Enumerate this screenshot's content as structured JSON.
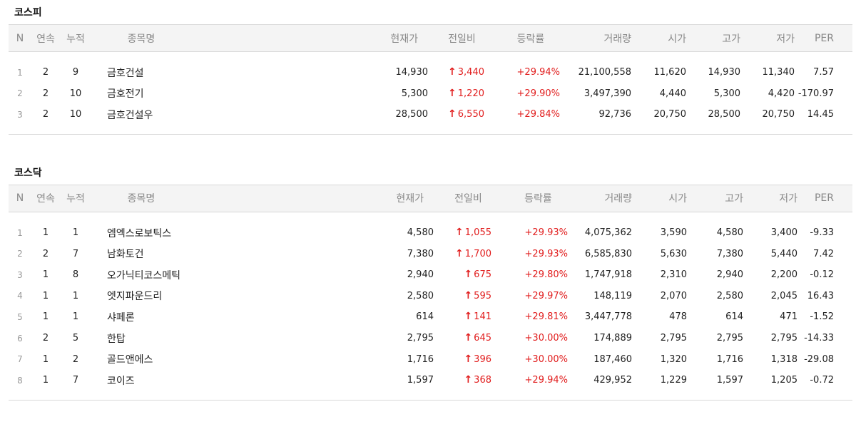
{
  "headers": [
    "N",
    "연속",
    "누적",
    "종목명",
    "현재가",
    "전일비",
    "등락률",
    "거래량",
    "시가",
    "고가",
    "저가",
    "PER"
  ],
  "icons": {
    "up": "arrow-up-icon"
  },
  "colors": {
    "up": "#e11d1d",
    "header_bg": "#f4f4f4",
    "border": "#d8d8d8"
  },
  "kospi": {
    "title": "코스피",
    "rows": [
      {
        "n": "1",
        "consec": "2",
        "cum": "9",
        "name": "금호건설",
        "price": "14,930",
        "change": "3,440",
        "rate": "+29.94%",
        "volume": "21,100,558",
        "open": "11,620",
        "high": "14,930",
        "low": "11,340",
        "per": "7.57"
      },
      {
        "n": "2",
        "consec": "2",
        "cum": "10",
        "name": "금호전기",
        "price": "5,300",
        "change": "1,220",
        "rate": "+29.90%",
        "volume": "3,497,390",
        "open": "4,440",
        "high": "5,300",
        "low": "4,420",
        "per": "-170.97"
      },
      {
        "n": "3",
        "consec": "2",
        "cum": "10",
        "name": "금호건설우",
        "price": "28,500",
        "change": "6,550",
        "rate": "+29.84%",
        "volume": "92,736",
        "open": "20,750",
        "high": "28,500",
        "low": "20,750",
        "per": "14.45"
      }
    ]
  },
  "kosdaq": {
    "title": "코스닥",
    "rows": [
      {
        "n": "1",
        "consec": "1",
        "cum": "1",
        "name": "엠엑스로보틱스",
        "price": "4,580",
        "change": "1,055",
        "rate": "+29.93%",
        "volume": "4,075,362",
        "open": "3,590",
        "high": "4,580",
        "low": "3,400",
        "per": "-9.33"
      },
      {
        "n": "2",
        "consec": "2",
        "cum": "7",
        "name": "남화토건",
        "price": "7,380",
        "change": "1,700",
        "rate": "+29.93%",
        "volume": "6,585,830",
        "open": "5,630",
        "high": "7,380",
        "low": "5,440",
        "per": "7.42"
      },
      {
        "n": "3",
        "consec": "1",
        "cum": "8",
        "name": "오가닉티코스메틱",
        "price": "2,940",
        "change": "675",
        "rate": "+29.80%",
        "volume": "1,747,918",
        "open": "2,310",
        "high": "2,940",
        "low": "2,200",
        "per": "-0.12"
      },
      {
        "n": "4",
        "consec": "1",
        "cum": "1",
        "name": "엣지파운드리",
        "price": "2,580",
        "change": "595",
        "rate": "+29.97%",
        "volume": "148,119",
        "open": "2,070",
        "high": "2,580",
        "low": "2,045",
        "per": "16.43"
      },
      {
        "n": "5",
        "consec": "1",
        "cum": "1",
        "name": "샤페론",
        "price": "614",
        "change": "141",
        "rate": "+29.81%",
        "volume": "3,447,778",
        "open": "478",
        "high": "614",
        "low": "471",
        "per": "-1.52"
      },
      {
        "n": "6",
        "consec": "2",
        "cum": "5",
        "name": "한탑",
        "price": "2,795",
        "change": "645",
        "rate": "+30.00%",
        "volume": "174,889",
        "open": "2,795",
        "high": "2,795",
        "low": "2,795",
        "per": "-14.33"
      },
      {
        "n": "7",
        "consec": "1",
        "cum": "2",
        "name": "골드앤에스",
        "price": "1,716",
        "change": "396",
        "rate": "+30.00%",
        "volume": "187,460",
        "open": "1,320",
        "high": "1,716",
        "low": "1,318",
        "per": "-29.08"
      },
      {
        "n": "8",
        "consec": "1",
        "cum": "7",
        "name": "코이즈",
        "price": "1,597",
        "change": "368",
        "rate": "+29.94%",
        "volume": "429,952",
        "open": "1,229",
        "high": "1,597",
        "low": "1,205",
        "per": "-0.72"
      }
    ]
  }
}
